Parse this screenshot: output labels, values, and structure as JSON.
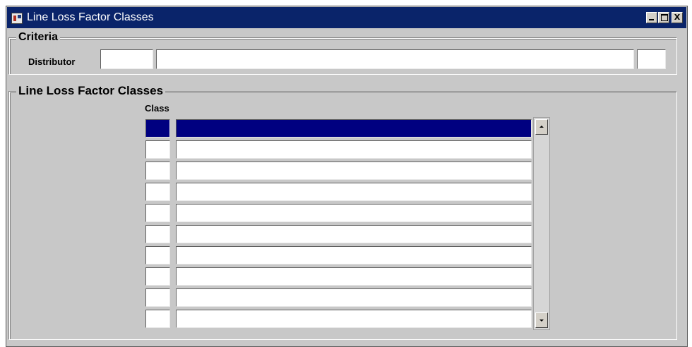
{
  "window": {
    "title": "Line Loss Factor Classes",
    "icon": "oracle-forms-app-icon",
    "controls": {
      "minimize_icon": "minimize-icon",
      "maximize_icon": "maximize-icon",
      "close_label": "X"
    }
  },
  "criteria": {
    "title": "Criteria",
    "distributor_label": "Distributor",
    "distributor_code": "",
    "distributor_name": "",
    "distributor_extra": ""
  },
  "llfc": {
    "title": "Line Loss Factor Classes",
    "column_header": "Class",
    "rows": [
      {
        "flag": "",
        "value": "",
        "selected": true
      },
      {
        "flag": "",
        "value": ""
      },
      {
        "flag": "",
        "value": ""
      },
      {
        "flag": "",
        "value": ""
      },
      {
        "flag": "",
        "value": ""
      },
      {
        "flag": "",
        "value": ""
      },
      {
        "flag": "",
        "value": ""
      },
      {
        "flag": "",
        "value": ""
      },
      {
        "flag": "",
        "value": ""
      },
      {
        "flag": "",
        "value": ""
      }
    ]
  },
  "colors": {
    "title_bar": "#0a246a",
    "selection": "#000080",
    "window_bg": "#c8c8c8"
  }
}
